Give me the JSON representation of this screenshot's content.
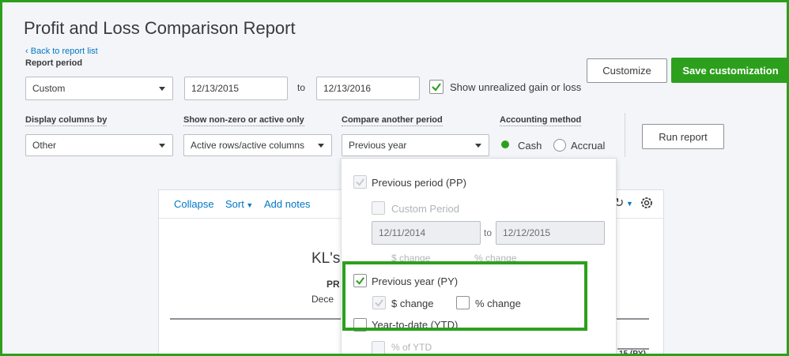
{
  "title": "Profit and Loss Comparison Report",
  "back_link": "Back to report list",
  "report_period": {
    "label": "Report period",
    "preset": "Custom",
    "from": "12/13/2015",
    "to_label": "to",
    "to": "12/13/2016",
    "unrealized_label": "Show unrealized gain or loss",
    "unrealized_checked": true
  },
  "buttons": {
    "customize": "Customize",
    "save": "Save customization",
    "run": "Run report"
  },
  "filters": {
    "display_columns_label": "Display columns by",
    "display_columns_value": "Other",
    "nonzero_label": "Show non-zero or active only",
    "nonzero_value": "Active rows/active columns",
    "compare_label": "Compare another period",
    "compare_value": "Previous year",
    "accounting_label": "Accounting method",
    "cash": "Cash",
    "accrual": "Accrual",
    "selected_method": "Cash"
  },
  "report": {
    "collapse": "Collapse",
    "sort": "Sort",
    "add_notes": "Add notes",
    "company_fragment": "KL's",
    "subtitle_fragment": "PR",
    "date_fragment": "Dece",
    "column_fragment": "15 (PY)"
  },
  "compare_dropdown": {
    "previous_period": "Previous period (PP)",
    "custom_period": "Custom Period",
    "pp_from": "12/11/2014",
    "pp_to_label": "to",
    "pp_to": "12/12/2015",
    "dollar_change_hidden": "$ change",
    "pct_change_hidden": "% change",
    "previous_year": "Previous year (PY)",
    "py_dollar_change": "$ change",
    "py_pct_change": "% change",
    "ytd": "Year-to-date (YTD)",
    "pct_of_ytd": "% of YTD"
  },
  "colors": {
    "accent_green": "#2ca01c",
    "link_blue": "#0077c5"
  }
}
